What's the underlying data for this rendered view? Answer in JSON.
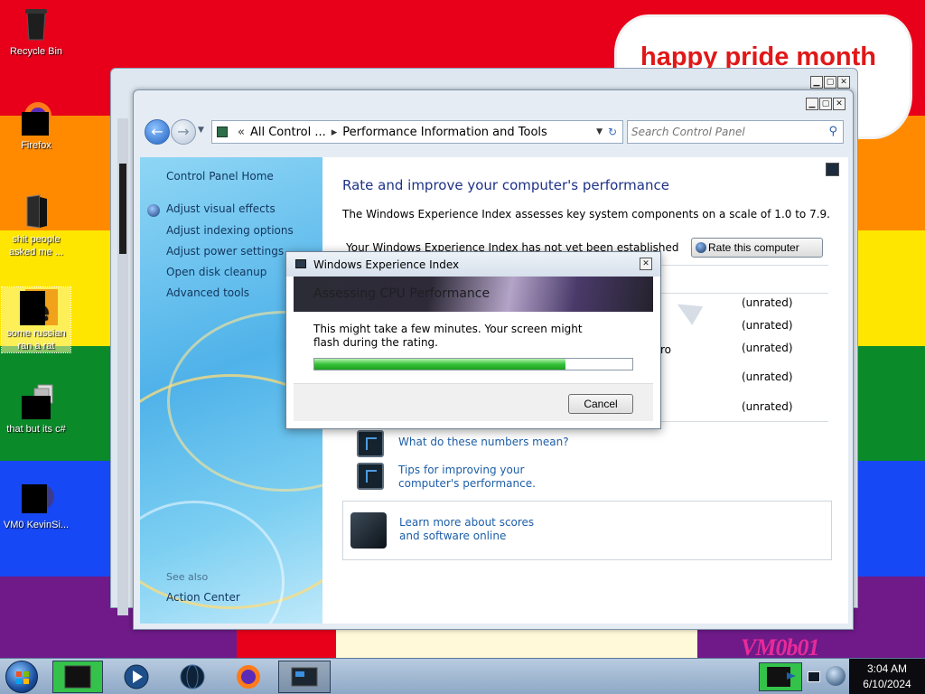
{
  "wallpaper": {
    "bubble_text": "happy pride month",
    "signature": "VM0b01",
    "stripe_colors": [
      "#e8001a",
      "#ff8a00",
      "#ffe600",
      "#0b8a29",
      "#1748f5",
      "#6f1a88"
    ]
  },
  "desktop_icons": [
    {
      "label": "Recycle Bin",
      "icon": "recycle-bin-icon"
    },
    {
      "label": "Firefox",
      "icon": "firefox-icon"
    },
    {
      "label": "shit people asked me ...",
      "icon": "folder-icon"
    },
    {
      "label": "some russian ran a rat",
      "icon": "file-icon"
    },
    {
      "label": "that but its c#",
      "icon": "copy-icon"
    },
    {
      "label": "VM0 KevinSi...",
      "icon": "app-icon"
    }
  ],
  "window": {
    "breadcrumb": [
      "All Control ...",
      "Performance Information and Tools"
    ],
    "search_placeholder": "Search Control Panel",
    "caption_buttons": {
      "minimize": "▁",
      "maximize": "▢",
      "close": "✕"
    }
  },
  "sidebar": {
    "home": "Control Panel Home",
    "items": [
      "Adjust visual effects",
      "Adjust indexing options",
      "Adjust power settings",
      "Open disk cleanup",
      "Advanced tools"
    ],
    "see_also_heading": "See also",
    "see_also_items": [
      "Action Center"
    ]
  },
  "content": {
    "title": "Rate and improve your computer's performance",
    "description": "The Windows Experience Index assesses key system components on a scale of 1.0 to 7.9.",
    "status": "Your Windows Experience Index has not yet been established",
    "rate_button": "Rate this computer",
    "scores": [
      "(unrated)",
      "(unrated)",
      "(unrated)",
      "(unrated)",
      "(unrated)"
    ],
    "partial_text": "ro",
    "links": [
      "What do these numbers mean?",
      "Tips for improving your computer's performance."
    ],
    "learn_more": "Learn more about scores and software online"
  },
  "dialog": {
    "title": "Windows Experience Index",
    "banner": "Assessing CPU Performance",
    "message": "This might take a few minutes. Your screen might flash during the rating.",
    "progress_fraction": 0.79,
    "cancel": "Cancel"
  },
  "taskbar": {
    "time": "3:04 AM",
    "date": "6/10/2024",
    "items": [
      "app-window-icon",
      "media-player-icon",
      "globe-icon",
      "firefox-icon",
      "performance-window-icon"
    ]
  }
}
